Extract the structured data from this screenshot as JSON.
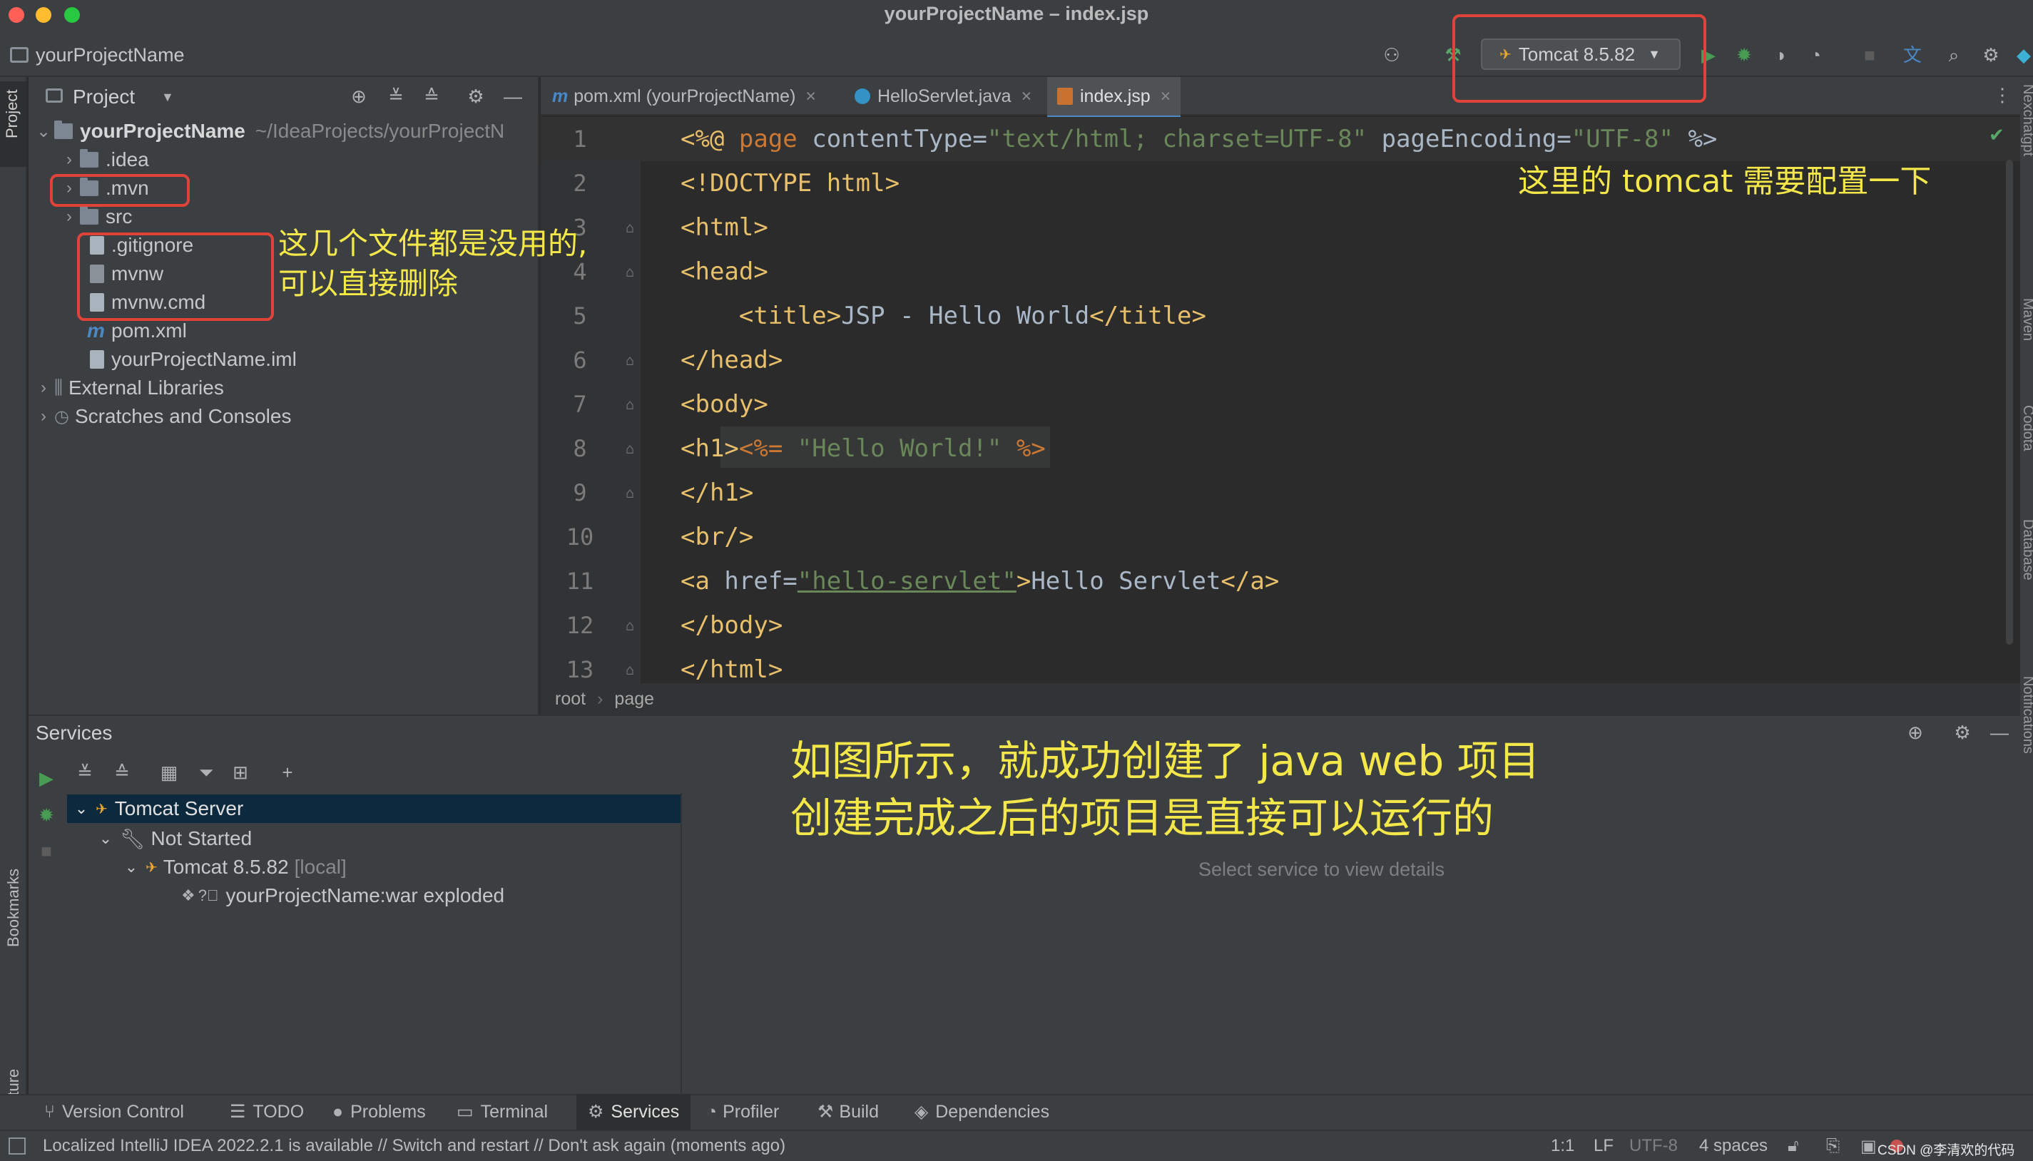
{
  "window": {
    "title": "yourProjectName – index.jsp"
  },
  "navbar": {
    "project": "yourProjectName",
    "run_config": "Tomcat 8.5.82"
  },
  "project_panel": {
    "header": "Project",
    "root": {
      "name": "yourProjectName",
      "path": "~/IdeaProjects/yourProjectN"
    },
    "items": [
      ".idea",
      ".mvn",
      "src",
      ".gitignore",
      "mvnw",
      "mvnw.cmd",
      "pom.xml",
      "yourProjectName.iml"
    ],
    "external": "External Libraries",
    "scratches": "Scratches and Consoles"
  },
  "tabs": [
    "pom.xml (yourProjectName)",
    "HelloServlet.java",
    "index.jsp"
  ],
  "editor": {
    "line_numbers": [
      "1",
      "2",
      "3",
      "4",
      "5",
      "6",
      "7",
      "8",
      "9",
      "10",
      "11",
      "12",
      "13"
    ],
    "lines": [
      [
        [
          "tag",
          "<%@ "
        ],
        [
          "kw",
          "page "
        ],
        [
          "txt",
          "contentType="
        ],
        [
          "str",
          "\"text/html; charset=UTF-8\""
        ],
        [
          "txt",
          " pageEncoding="
        ],
        [
          "str",
          "\"UTF-8\""
        ],
        [
          "txt",
          " %>"
        ]
      ],
      [
        [
          "tag",
          "<!DOCTYPE html>"
        ]
      ],
      [
        [
          "tag",
          "<html>"
        ]
      ],
      [
        [
          "tag",
          "<head>"
        ]
      ],
      [
        [
          "txt",
          "    "
        ],
        [
          "tag",
          "<title>"
        ],
        [
          "txt",
          "JSP - Hello World"
        ],
        [
          "tag",
          "</title>"
        ]
      ],
      [
        [
          "tag",
          "</head>"
        ]
      ],
      [
        [
          "tag",
          "<body>"
        ]
      ],
      [
        [
          "tag",
          "<h1>"
        ],
        [
          "kw",
          "<%= "
        ],
        [
          "str",
          "\"Hello World!\""
        ],
        [
          "kw",
          " %>"
        ]
      ],
      [
        [
          "tag",
          "</h1>"
        ]
      ],
      [
        [
          "tag",
          "<br/>"
        ]
      ],
      [
        [
          "tag",
          "<a "
        ],
        [
          "txt",
          "href="
        ],
        [
          "str",
          "\"hello-servlet\""
        ],
        [
          "tag",
          ">"
        ],
        [
          "txt",
          "Hello Servlet"
        ],
        [
          "tag",
          "</a>"
        ]
      ],
      [
        [
          "tag",
          "</body>"
        ]
      ],
      [
        [
          "tag",
          "</html>"
        ]
      ]
    ],
    "breadcrumb": [
      "root",
      "page"
    ]
  },
  "services": {
    "title": "Services",
    "tree": [
      "Tomcat Server",
      "Not Started",
      "Tomcat 8.5.82",
      "[local]",
      "yourProjectName:war exploded"
    ],
    "detail_placeholder": "Select service to view details"
  },
  "annotations": {
    "tomcat_note": "这里的 tomcat 需要配置一下",
    "files_note_1": "这几个文件都是没用的,",
    "files_note_2": "可以直接删除",
    "main_note_1": "如图所示，就成功创建了 java web 项目",
    "main_note_2": "创建完成之后的项目是直接可以运行的"
  },
  "side_tools": {
    "left_top": "Project",
    "left_bookmarks": "Bookmarks",
    "left_structure": "Structure",
    "right": [
      "Nexchatgpt",
      "Maven",
      "Codota",
      "Database",
      "Notifications"
    ]
  },
  "bottom_tabs": [
    "Version Control",
    "TODO",
    "Problems",
    "Terminal",
    "Services",
    "Profiler",
    "Build",
    "Dependencies"
  ],
  "status": {
    "message": "Localized IntelliJ IDEA 2022.2.1 is available // Switch and restart // Don't ask again (moments ago)",
    "position": "1:1",
    "line_sep": "LF",
    "encoding": "UTF-8",
    "indent": "4 spaces",
    "watermark": "CSDN @李清欢的代码"
  },
  "colors": {
    "highlight": "#e0433a",
    "annotation": "#f3e74a",
    "tag": "#e8bf6a",
    "string": "#6a8759",
    "keyword": "#cc7832"
  }
}
